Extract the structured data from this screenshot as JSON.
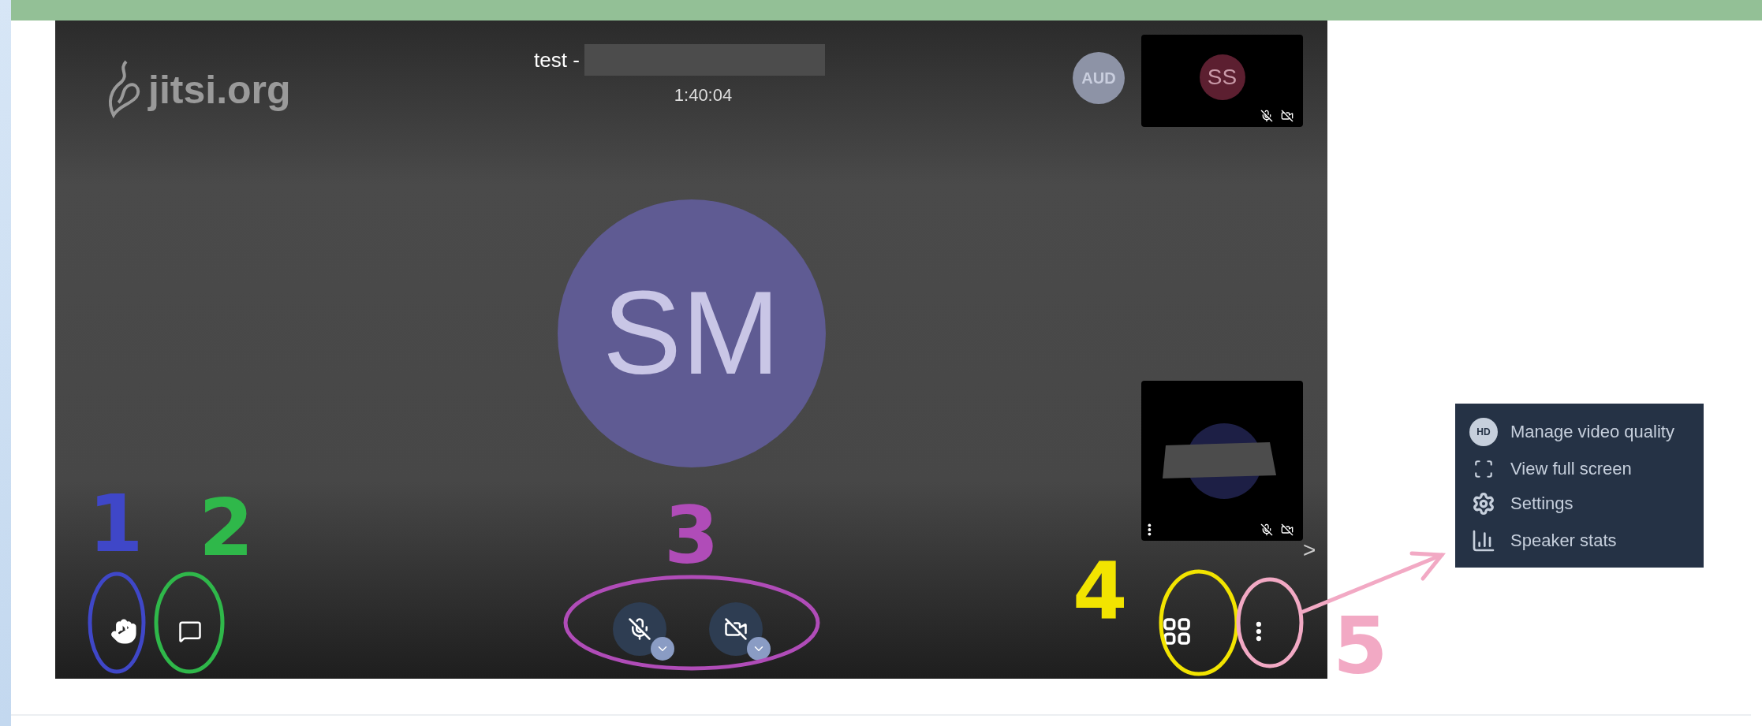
{
  "logo": {
    "text": "jitsi.org"
  },
  "header": {
    "title": "test -",
    "title_redacted": true,
    "timer": "1:40:04"
  },
  "dominant_speaker": {
    "initials": "AUD"
  },
  "main_avatar": {
    "initials": "SM"
  },
  "thumbnails": [
    {
      "kind": "avatar",
      "initials": "SS",
      "mic_muted": true,
      "camera_off": true,
      "menu": false
    },
    {
      "kind": "redacted",
      "mic_muted": true,
      "camera_off": true,
      "menu": true
    }
  ],
  "filmstrip_toggle": {
    "text": ">"
  },
  "toolbar": {
    "left": [
      {
        "kind": "raise-hand"
      },
      {
        "kind": "chat"
      }
    ],
    "center": [
      {
        "kind": "mic",
        "muted": true
      },
      {
        "kind": "camera",
        "muted": true
      }
    ],
    "right": [
      {
        "kind": "tile-view"
      },
      {
        "kind": "more"
      }
    ]
  },
  "annotations": [
    {
      "label": "1",
      "color": "#3f47c8"
    },
    {
      "label": "2",
      "color": "#2fb84a"
    },
    {
      "label": "3",
      "color": "#b04cb8"
    },
    {
      "label": "4",
      "color": "#f2e400"
    },
    {
      "label": "5",
      "color": "#f2a9c4"
    }
  ],
  "menu": {
    "items": [
      {
        "kind": "video-quality",
        "badge": "HD",
        "label": "Manage video quality"
      },
      {
        "kind": "fullscreen",
        "label": "View full screen"
      },
      {
        "kind": "settings",
        "label": "Settings"
      },
      {
        "kind": "speaker-stats",
        "label": "Speaker stats"
      }
    ]
  }
}
